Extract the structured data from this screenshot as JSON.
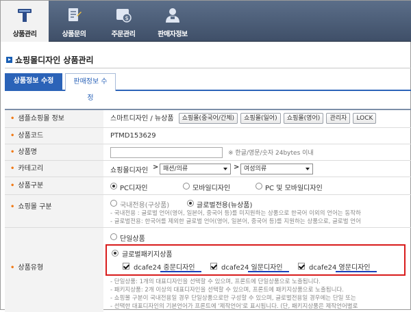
{
  "nav": {
    "items": [
      {
        "label": "상품관리",
        "icon": "product-management-icon",
        "active": true
      },
      {
        "label": "상품문의",
        "icon": "product-inquiry-icon",
        "active": false
      },
      {
        "label": "주문관리",
        "icon": "order-management-icon",
        "active": false
      },
      {
        "label": "판매자정보",
        "icon": "seller-info-icon",
        "active": false
      }
    ]
  },
  "page": {
    "title": "쇼핑몰디자인 상품관리"
  },
  "tabs": [
    {
      "label": "상품정보 수정",
      "active": true
    },
    {
      "label": "판매정보 수정",
      "active": false
    }
  ],
  "form": {
    "sample_mall": {
      "label": "샘플쇼핑몰 정보",
      "text": "스마트디자인 / 뉴상품",
      "buttons": [
        "쇼핑몰(중국어/간체)",
        "쇼핑몰(일어)",
        "쇼핑몰(영어)",
        "관리자",
        "LOCK"
      ]
    },
    "product_code": {
      "label": "상품코드",
      "value": "PTMD153629"
    },
    "product_name": {
      "label": "상품명",
      "value": "",
      "hint": "※ 한글/영문/숫자 24bytes 이내"
    },
    "category": {
      "label": "카테고리",
      "root": "쇼핑몰디자인",
      "sel1": "패션/의류",
      "sel2": "여성의류"
    },
    "product_type": {
      "label": "상품구분",
      "options": [
        {
          "label": "PC디자인",
          "selected": true
        },
        {
          "label": "모바일디자인",
          "selected": false
        },
        {
          "label": "PC 및 모바일디자인",
          "selected": false
        }
      ]
    },
    "mall_type": {
      "label": "쇼핑몰 구분",
      "options": [
        {
          "label": "국내전용(구상품)",
          "selected": false
        },
        {
          "label": "글로벌전용(뉴상품)",
          "selected": true
        }
      ],
      "notes": [
        "- 국내전용 : 글로벌 언어(영어, 일본어, 중국어 등)를 미지원하는 상품으로 한국어 이외의 언어는 동작하",
        "- 글로벌전용: 한국어를 제외한 글로벌 언어(영어, 일본어, 중국어 등)를 지원하는 상품으로, 글로벌 언어"
      ]
    },
    "product_kind": {
      "label": "상품유형",
      "single": "단일상품",
      "package": "글로벌패키지상품",
      "single_selected": false,
      "package_selected": true,
      "checks": [
        {
          "label": "dcafe24 중문디자인",
          "checked": true
        },
        {
          "label": "dcafe24 일문디자인",
          "checked": true
        },
        {
          "label": "dcafe24 영문디자인",
          "checked": true
        }
      ],
      "notes": [
        "- 단일상품: 1개의 대표디자인을 선택할 수 있으며, 프론트에 단일상품으로 노출됩니다.",
        "- 패키지상품: 2개 이상의 대표디자인을 선택할 수 있으며, 프론트에 패키지상품으로 노출됩니다.",
        "- 쇼핑몰 구분이 국내전용일 경우 단일상품으로만 구성할 수 있으며, 글로벌전용일 경우에는 단일 또는",
        "- 선택한 대표디자인의 기본언어가 프론트에 '제작언어'로 표시됩니다. (단, 패키지상품은 제작언어별로"
      ]
    }
  },
  "colors": {
    "accent": "#2b63b8",
    "highlight": "#d81a1a",
    "required": "#f07a17"
  }
}
